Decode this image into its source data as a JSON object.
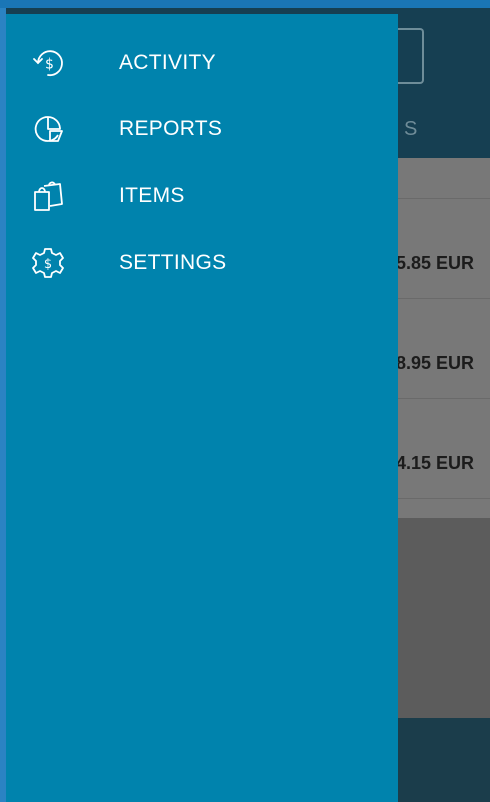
{
  "background": {
    "tab_partial": "S",
    "amounts": [
      "5.85 EUR",
      "8.95 EUR",
      "4.15 EUR"
    ]
  },
  "drawer": {
    "items": [
      {
        "label": "ACTIVITY",
        "icon": "dollar-refresh-icon"
      },
      {
        "label": "REPORTS",
        "icon": "pie-chart-icon"
      },
      {
        "label": "ITEMS",
        "icon": "shopping-bags-icon"
      },
      {
        "label": "SETTINGS",
        "icon": "dollar-gear-icon"
      }
    ]
  },
  "colors": {
    "drawer": "#0083ad",
    "header_dim": "#163f52",
    "list_dim": "#787878",
    "top_strip": "#1a76b6"
  }
}
